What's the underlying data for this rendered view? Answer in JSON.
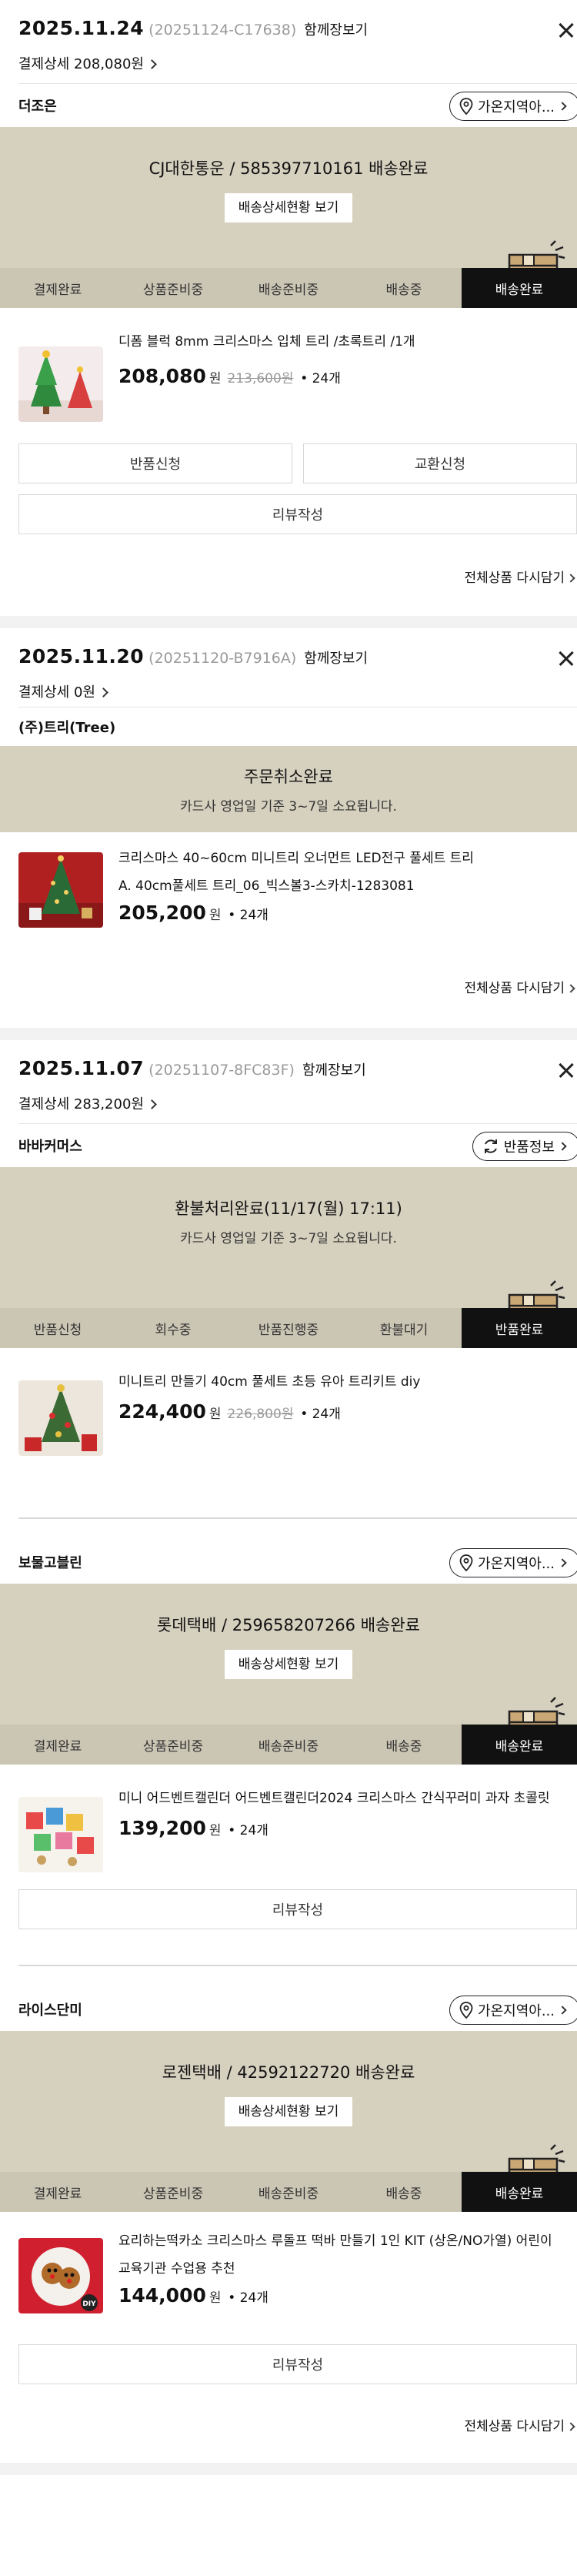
{
  "orders": [
    {
      "date": "2025.11.24",
      "code": "(20251124-C17638)",
      "together": "함께장보기",
      "paydetail": "결제상세 208,080원",
      "sellers": [
        {
          "name": "더조은",
          "pill": "가온지역아...",
          "status_main": "CJ대한통운 / 585397710161 배송완료",
          "track_btn": "배송상세현황 보기",
          "steps": [
            "결제완료",
            "상품준비중",
            "배송준비중",
            "배송중",
            "배송완료"
          ],
          "active_step": 4,
          "product": {
            "name": "디폼 블럭 8mm 크리스마스 입체 트리 /초록트리 /1개",
            "name2": "",
            "price": "208,080",
            "won": "원",
            "original": "213,600원",
            "qty": "• 24개"
          },
          "buttons": [
            "반품신청",
            "교환신청"
          ],
          "wide_btn": "리뷰작성"
        }
      ],
      "reorder": "전체상품 다시담기"
    },
    {
      "date": "2025.11.20",
      "code": "(20251120-B7916A)",
      "together": "함께장보기",
      "paydetail": "결제상세 0원",
      "sellers": [
        {
          "name": "(주)트리(Tree)",
          "status_main": "주문취소완료",
          "status_sub": "카드사 영업일 기준 3~7일 소요됩니다.",
          "product": {
            "name": "크리스마스 40~60cm 미니트리 오너먼트 LED전구 풀세트 트리",
            "name2": "A. 40cm풀세트 트리_06_빅스볼3-스카치-1283081",
            "price": "205,200",
            "won": "원",
            "qty": "• 24개"
          }
        }
      ],
      "reorder": "전체상품 다시담기"
    },
    {
      "date": "2025.11.07",
      "code": "(20251107-8FC83F)",
      "together": "함께장보기",
      "paydetail": "결제상세 283,200원",
      "sellers": [
        {
          "name": "바바커머스",
          "pill": "반품정보",
          "status_main": "환불처리완료(11/17(월) 17:11)",
          "status_sub": "카드사 영업일 기준 3~7일 소요됩니다.",
          "steps": [
            "반품신청",
            "회수중",
            "반품진행중",
            "환불대기",
            "반품완료"
          ],
          "active_step": 4,
          "product": {
            "name": "미니트리 만들기 40cm 풀세트 초등 유아 트리키트 diy",
            "price": "224,400",
            "won": "원",
            "original": "226,800원",
            "qty": "• 24개"
          }
        },
        {
          "name": "보물고블린",
          "pill": "가온지역아...",
          "status_main": "롯데택배 / 259658207266 배송완료",
          "track_btn": "배송상세현황 보기",
          "steps": [
            "결제완료",
            "상품준비중",
            "배송준비중",
            "배송중",
            "배송완료"
          ],
          "active_step": 4,
          "product": {
            "name": "미니 어드벤트캘린더 어드벤트캘린더2024 크리스마스 간식꾸러미 과자 초콜릿",
            "price": "139,200",
            "won": "원",
            "qty": "• 24개"
          },
          "wide_btn": "리뷰작성"
        },
        {
          "name": "라이스단미",
          "pill": "가온지역아...",
          "status_main": "로젠택배 / 42592122720 배송완료",
          "track_btn": "배송상세현황 보기",
          "steps": [
            "결제완료",
            "상품준비중",
            "배송준비중",
            "배송중",
            "배송완료"
          ],
          "active_step": 4,
          "product": {
            "name": "요리하는떡카소 크리스마스 루돌프 떡바 만들기 1인 KIT (상온/NO가열) 어린이",
            "name2": "교육기관 수업용 추천",
            "price": "144,000",
            "won": "원",
            "qty": "• 24개",
            "badge": "DIY"
          },
          "wide_btn": "리뷰작성"
        }
      ],
      "reorder": "전체상품 다시담기"
    }
  ],
  "colors": {
    "status_bg": "#d6d0bf",
    "active_step": "#111111"
  }
}
